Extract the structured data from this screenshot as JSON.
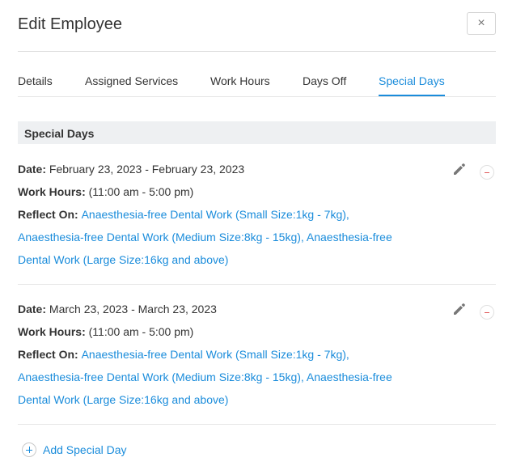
{
  "header": {
    "title": "Edit Employee",
    "close_glyph": "×"
  },
  "tabs": [
    {
      "label": "Details"
    },
    {
      "label": "Assigned Services"
    },
    {
      "label": "Work Hours"
    },
    {
      "label": "Days Off"
    },
    {
      "label": "Special Days",
      "active": true
    }
  ],
  "section": {
    "title": "Special Days"
  },
  "labels": {
    "date": "Date:",
    "work_hours": "Work Hours:",
    "reflect_on": "Reflect On:"
  },
  "entries": [
    {
      "date": "February 23, 2023 - February 23, 2023",
      "work_hours": "(11:00 am - 5:00 pm)",
      "reflect_lines": [
        "Anaesthesia-free Dental Work (Small Size:1kg - 7kg),",
        "Anaesthesia-free Dental Work (Medium Size:8kg - 15kg), Anaesthesia-free",
        "Dental Work (Large Size:16kg and above)"
      ]
    },
    {
      "date": "March 23, 2023 - March 23, 2023",
      "work_hours": "(11:00 am - 5:00 pm)",
      "reflect_lines": [
        "Anaesthesia-free Dental Work (Small Size:1kg - 7kg),",
        "Anaesthesia-free Dental Work (Medium Size:8kg - 15kg), Anaesthesia-free",
        "Dental Work (Large Size:16kg and above)"
      ]
    }
  ],
  "footer": {
    "add_label": "Add Special Day"
  },
  "colors": {
    "accent": "#1a8cdb",
    "remove": "#e05a5a",
    "section_bg": "#eef0f2"
  },
  "icons": {
    "edit": "pencil-icon",
    "remove": "minus-circle-icon",
    "add": "plus-circle-icon",
    "close": "close-icon"
  }
}
